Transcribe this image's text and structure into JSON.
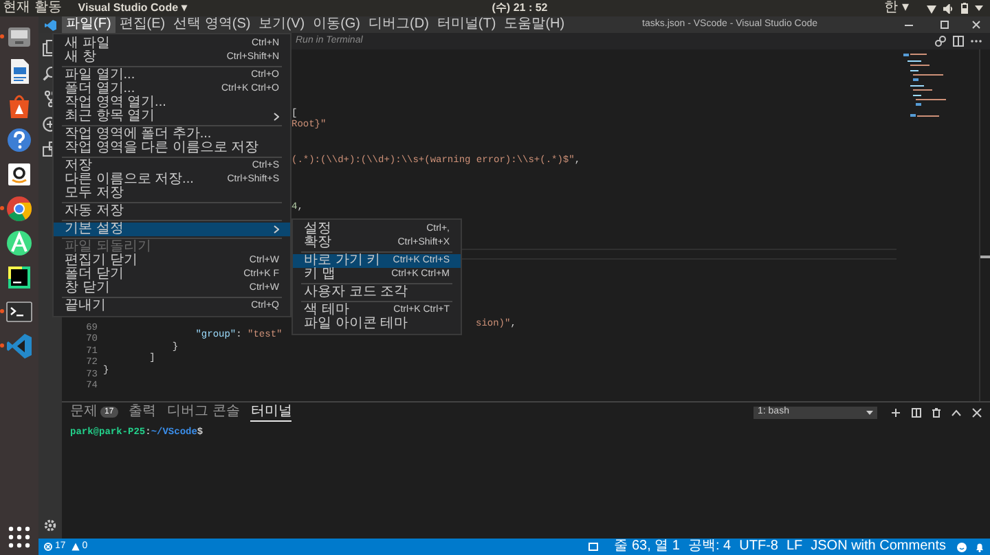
{
  "top_bar": {
    "activities": "현재 활동",
    "app_menu": "Visual Studio Code ▾",
    "clock": "(수) 21 : 52",
    "input_method": "한 ▾"
  },
  "launcher": [
    {
      "kind": "files",
      "running": true
    },
    {
      "kind": "writer",
      "running": false
    },
    {
      "kind": "software",
      "running": false
    },
    {
      "kind": "help",
      "running": false
    },
    {
      "kind": "amazon",
      "running": false
    },
    {
      "kind": "chrome",
      "running": true
    },
    {
      "kind": "android",
      "running": false
    },
    {
      "kind": "pycharm",
      "running": false
    },
    {
      "kind": "terminal",
      "running": true
    },
    {
      "kind": "vscode",
      "running": true
    },
    {
      "kind": "apps",
      "running": false
    }
  ],
  "window": {
    "title": "tasks.json - VScode - Visual Studio Code"
  },
  "menu_bar": [
    {
      "label": "파일(F)",
      "selected": true
    },
    {
      "label": "편집(E)",
      "selected": false
    },
    {
      "label": "선택 영역(S)",
      "selected": false
    },
    {
      "label": "보기(V)",
      "selected": false
    },
    {
      "label": "이동(G)",
      "selected": false
    },
    {
      "label": "디버그(D)",
      "selected": false
    },
    {
      "label": "터미널(T)",
      "selected": false
    },
    {
      "label": "도움말(H)",
      "selected": false
    }
  ],
  "editor": {
    "hint": "Run in Terminal",
    "lines": [
      {
        "kind": "blank",
        "current": false
      },
      {
        "kind": "blank",
        "current": false
      },
      {
        "kind": "blank",
        "current": false
      },
      {
        "kind": "blank",
        "current": false
      },
      {
        "kind": "blank",
        "current": false
      },
      {
        "kind": "fragment",
        "current": false,
        "tokens": [
          {
            "text": "["
          }
        ]
      },
      {
        "kind": "fragment",
        "current": false,
        "tokens": [
          {
            "text": "Root}\"",
            "color": "#ce9178"
          }
        ]
      },
      {
        "kind": "blank",
        "current": false
      },
      {
        "kind": "blank",
        "current": false
      },
      {
        "kind": "fragment",
        "current": false,
        "tokens": [
          {
            "text": "(.*):(\\\\d+):(\\\\d+):\\\\s+(warning error):\\\\s+(.*)$\"",
            "color": "#ce9178"
          },
          {
            "text": ","
          }
        ]
      },
      {
        "kind": "blank",
        "current": false
      },
      {
        "kind": "blank",
        "current": false
      },
      {
        "kind": "blank",
        "current": false
      },
      {
        "kind": "fragment",
        "current": false,
        "tokens": [
          {
            "text": "4",
            "color": "#b5cea8"
          },
          {
            "text": ","
          }
        ]
      },
      {
        "kind": "blank",
        "current": false
      },
      {
        "kind": "blank",
        "current": false
      },
      {
        "kind": "blank",
        "current": false
      },
      {
        "kind": "blank",
        "current": true
      },
      {
        "kind": "blank",
        "current": false
      },
      {
        "kind": "blank",
        "current": false
      },
      {
        "kind": "blank",
        "current": false
      },
      {
        "kind": "blank",
        "current": false
      },
      {
        "kind": "blank",
        "current": false
      },
      {
        "kind": "far_fragment",
        "number": "69",
        "current": false,
        "tokens": [
          {
            "text": "sion)\"",
            "color": "#ce9178"
          },
          {
            "text": ","
          }
        ]
      },
      {
        "kind": "code",
        "number": "70",
        "current": false,
        "tokens": [
          {
            "text": "                \"group\"",
            "color": "#9cdcfe"
          },
          {
            "text": ": "
          },
          {
            "text": "\"test\"",
            "color": "#ce9178"
          }
        ]
      },
      {
        "kind": "code",
        "number": "71",
        "current": false,
        "tokens": [
          {
            "text": "            }"
          }
        ]
      },
      {
        "kind": "code",
        "number": "72",
        "current": false,
        "tokens": [
          {
            "text": "        ]"
          }
        ]
      },
      {
        "kind": "code",
        "number": "73",
        "current": false,
        "tokens": [
          {
            "text": "}"
          }
        ]
      },
      {
        "kind": "blank",
        "number": "74",
        "current": false
      }
    ]
  },
  "file_menu": [
    {
      "kind": "item",
      "label": "새 파일",
      "shortcut": "Ctrl+N",
      "submenu": false,
      "selected": false,
      "disabled": false
    },
    {
      "kind": "item",
      "label": "새 창",
      "shortcut": "Ctrl+Shift+N",
      "submenu": false,
      "selected": false,
      "disabled": false
    },
    {
      "kind": "separator"
    },
    {
      "kind": "item",
      "label": "파일 열기...",
      "shortcut": "Ctrl+O",
      "submenu": false,
      "selected": false,
      "disabled": false
    },
    {
      "kind": "item",
      "label": "폴더 열기...",
      "shortcut": "Ctrl+K Ctrl+O",
      "submenu": false,
      "selected": false,
      "disabled": false
    },
    {
      "kind": "item",
      "label": "작업 영역 열기...",
      "submenu": false,
      "selected": false,
      "disabled": false
    },
    {
      "kind": "item",
      "label": "최근 항목 열기",
      "submenu": true,
      "selected": false,
      "disabled": false
    },
    {
      "kind": "separator"
    },
    {
      "kind": "item",
      "label": "작업 영역에 폴더 추가...",
      "submenu": false,
      "selected": false,
      "disabled": false
    },
    {
      "kind": "item",
      "label": "작업 영역을 다른 이름으로 저장",
      "submenu": false,
      "selected": false,
      "disabled": false
    },
    {
      "kind": "separator"
    },
    {
      "kind": "item",
      "label": "저장",
      "shortcut": "Ctrl+S",
      "submenu": false,
      "selected": false,
      "disabled": false
    },
    {
      "kind": "item",
      "label": "다른 이름으로 저장...",
      "shortcut": "Ctrl+Shift+S",
      "submenu": false,
      "selected": false,
      "disabled": false
    },
    {
      "kind": "item",
      "label": "모두 저장",
      "submenu": false,
      "selected": false,
      "disabled": false
    },
    {
      "kind": "separator"
    },
    {
      "kind": "item",
      "label": "자동 저장",
      "submenu": false,
      "selected": false,
      "disabled": false
    },
    {
      "kind": "separator"
    },
    {
      "kind": "item",
      "label": "기본 설정",
      "submenu": true,
      "selected": true,
      "disabled": false
    },
    {
      "kind": "separator"
    },
    {
      "kind": "item",
      "label": "파일 되돌리기",
      "submenu": false,
      "selected": false,
      "disabled": true
    },
    {
      "kind": "item",
      "label": "편집기 닫기",
      "shortcut": "Ctrl+W",
      "submenu": false,
      "selected": false,
      "disabled": false
    },
    {
      "kind": "item",
      "label": "폴더 닫기",
      "shortcut": "Ctrl+K F",
      "submenu": false,
      "selected": false,
      "disabled": false
    },
    {
      "kind": "item",
      "label": "창 닫기",
      "shortcut": "Ctrl+W",
      "submenu": false,
      "selected": false,
      "disabled": false
    },
    {
      "kind": "separator"
    },
    {
      "kind": "item",
      "label": "끝내기",
      "shortcut": "Ctrl+Q",
      "submenu": false,
      "selected": false,
      "disabled": false
    }
  ],
  "preferences_submenu": [
    {
      "kind": "item",
      "label": "설정",
      "shortcut": "Ctrl+,",
      "selected": false
    },
    {
      "kind": "item",
      "label": "확장",
      "shortcut": "Ctrl+Shift+X",
      "selected": false
    },
    {
      "kind": "separator"
    },
    {
      "kind": "item",
      "label": "바로 가기 키",
      "shortcut": "Ctrl+K Ctrl+S",
      "selected": true
    },
    {
      "kind": "item",
      "label": "키 맵",
      "shortcut": "Ctrl+K Ctrl+M",
      "selected": false
    },
    {
      "kind": "separator"
    },
    {
      "kind": "item",
      "label": "사용자 코드 조각",
      "selected": false
    },
    {
      "kind": "separator"
    },
    {
      "kind": "item",
      "label": "색 테마",
      "shortcut": "Ctrl+K Ctrl+T",
      "selected": false
    },
    {
      "kind": "item",
      "label": "파일 아이콘 테마",
      "selected": false
    }
  ],
  "panel": {
    "tabs": [
      {
        "label": "문제",
        "badge": "17",
        "selected": false
      },
      {
        "label": "출력",
        "selected": false
      },
      {
        "label": "디버그 콘솔",
        "selected": false
      },
      {
        "label": "터미널",
        "selected": true
      }
    ],
    "terminal_select": "1: bash",
    "prompt": {
      "user": "park@park-P25",
      "path": ":~/VScode",
      "symbol": "$"
    }
  },
  "status_bar": {
    "errors": "17",
    "warnings": "0",
    "items": [
      "줄 63, 열 1",
      "공백: 4",
      "UTF-8",
      "LF",
      "JSON with Comments"
    ]
  }
}
